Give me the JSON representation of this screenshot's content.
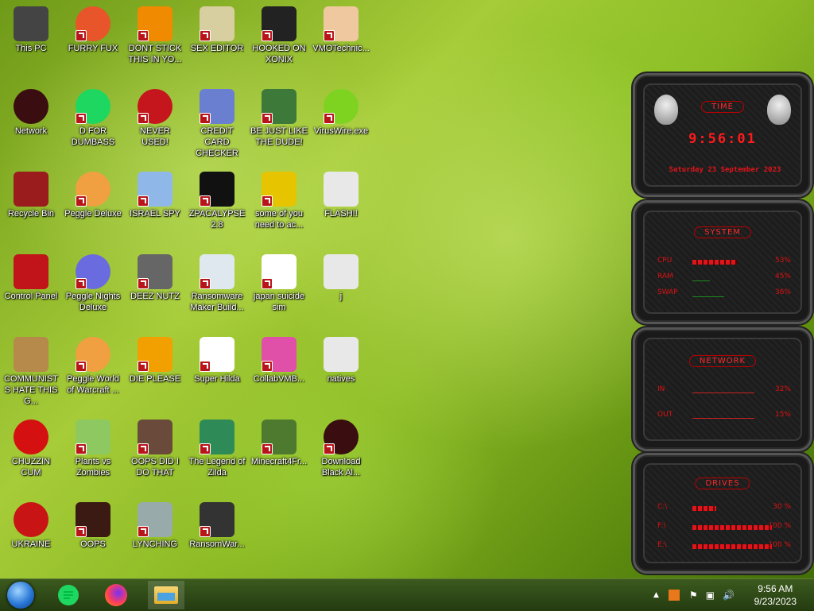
{
  "desktop_icons": [
    {
      "label": "This PC",
      "icon": "monitor-icon"
    },
    {
      "label": "FURRY FUX",
      "icon": "firefox-icon"
    },
    {
      "label": "DONT STICK THIS IN YO...",
      "icon": "vlc-cone-icon"
    },
    {
      "label": "SEX EDITOR",
      "icon": "hxd-icon"
    },
    {
      "label": "HOOKED ON XONIX",
      "icon": "xonix-icon"
    },
    {
      "label": "VMOTechnic...",
      "icon": "doctor-icon"
    },
    {
      "label": "Network",
      "icon": "red-orb-icon"
    },
    {
      "label": "D FOR DUMBASS",
      "icon": "chat-bubble-icon"
    },
    {
      "label": "NEVER USED!",
      "icon": "dev-cpp-icon"
    },
    {
      "label": "CREDIT CARD CHECKER",
      "icon": "credit-card-icon"
    },
    {
      "label": "BE JUST LIKE THE DUDE!",
      "icon": "santa-icon"
    },
    {
      "label": "VirusWire.exe",
      "icon": "lime-icon"
    },
    {
      "label": "Recycle Bin",
      "icon": "recycle-bin-icon"
    },
    {
      "label": "Peggle Deluxe",
      "icon": "peggle-icon"
    },
    {
      "label": "ISRAEL SPY",
      "icon": "network-share-icon"
    },
    {
      "label": "ZPACALYPSE 2.8",
      "icon": "terminal-icon"
    },
    {
      "label": "some of you need to ac...",
      "icon": "dog-icon"
    },
    {
      "label": "FLASH!!",
      "icon": "document-icon"
    },
    {
      "label": "Control Panel",
      "icon": "control-panel-icon"
    },
    {
      "label": "Peggle Nights Deluxe",
      "icon": "peggle-nights-icon"
    },
    {
      "label": "DEEZ NUTZ",
      "icon": "stack-icon"
    },
    {
      "label": "Ransomware Maker Build...",
      "icon": "window-icon"
    },
    {
      "label": "japan suicide sim",
      "icon": "figures-icon"
    },
    {
      "label": "j",
      "icon": "document-icon"
    },
    {
      "label": "COMMUNISTS HATE THIS G...",
      "icon": "money-bag-icon"
    },
    {
      "label": "Peggle World of Warcraft ...",
      "icon": "peggle-icon"
    },
    {
      "label": "DIE PLEASE",
      "icon": "de-icon"
    },
    {
      "label": "Super Hilda",
      "icon": "pixel-character-icon"
    },
    {
      "label": "CollabVMB...",
      "icon": "monitor-pink-icon"
    },
    {
      "label": "natives",
      "icon": "document-icon"
    },
    {
      "label": "CHUZZIN CUM",
      "icon": "red-fuzzball-icon"
    },
    {
      "label": "Plants vs Zombies",
      "icon": "flower-icon"
    },
    {
      "label": "OOPS DID I DO THAT",
      "icon": "portrait-icon"
    },
    {
      "label": "The Legend of Zilda",
      "icon": "zelda-icon"
    },
    {
      "label": "Minecraft4Fr...",
      "icon": "grass-block-icon"
    },
    {
      "label": "Download Black Al...",
      "icon": "red-orb-icon"
    },
    {
      "label": "UKRAINE",
      "icon": "radiation-icon"
    },
    {
      "label": "OOPS",
      "icon": "framed-portrait-icon"
    },
    {
      "label": "LYNCHING",
      "icon": "noose-icon"
    },
    {
      "label": "RansomWar...",
      "icon": "skull-icon"
    }
  ],
  "gadget": {
    "time": {
      "title": "TIME",
      "clock": "9:56:01",
      "date": "Saturday 23 September 2023"
    },
    "system": {
      "title": "SYSTEM",
      "rows": [
        {
          "name": "CPU",
          "value": "53%",
          "level": 0.53
        },
        {
          "name": "RAM",
          "value": "45%",
          "level": 0.45
        },
        {
          "name": "SWAP",
          "value": "36%",
          "level": 0.36
        }
      ]
    },
    "network": {
      "title": "NETWORK",
      "rows": [
        {
          "name": "IN",
          "value": "32%"
        },
        {
          "name": "OUT",
          "value": "15%"
        }
      ]
    },
    "drives": {
      "title": "DRIVES",
      "rows": [
        {
          "name": "C:\\",
          "value": "30 %",
          "level": 0.3
        },
        {
          "name": "F:\\",
          "value": "100 %",
          "level": 1.0
        },
        {
          "name": "E:\\",
          "value": "100 %",
          "level": 1.0
        }
      ]
    }
  },
  "taskbar": {
    "pinned": [
      "start-orb-icon",
      "chat-app-icon",
      "firefox-icon",
      "file-explorer-icon"
    ],
    "clock_time": "9:56 AM",
    "clock_date": "9/23/2023"
  }
}
